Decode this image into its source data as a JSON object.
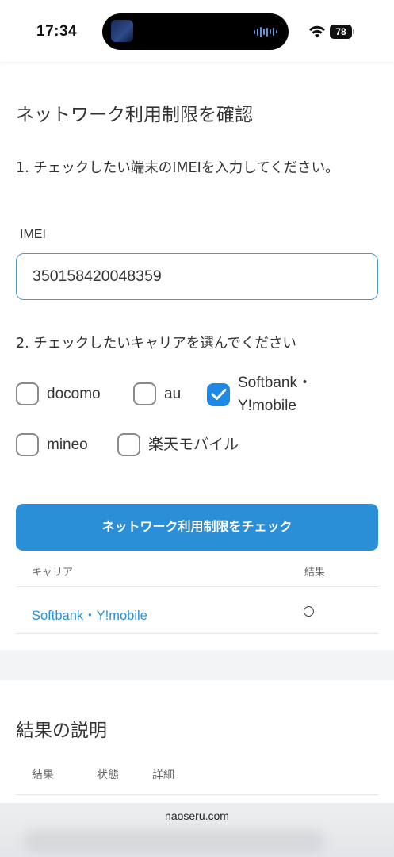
{
  "status_bar": {
    "time": "17:34",
    "battery": "78",
    "icons": [
      "wifi-icon",
      "battery-icon",
      "audio-wave-icon"
    ]
  },
  "page": {
    "title": "ネットワーク利用制限を確認",
    "step1": "1. チェックしたい端末のIMEIを入力してください。",
    "imei_label": "IMEI",
    "imei_value": "350158420048359",
    "step2": "2. チェックしたいキャリアを選んでください",
    "carriers": [
      {
        "label": "docomo",
        "checked": false
      },
      {
        "label": "au",
        "checked": false
      },
      {
        "label": "Softbank・Y!mobile",
        "checked": true
      },
      {
        "label": "mineo",
        "checked": false
      },
      {
        "label": "楽天モバイル",
        "checked": false
      }
    ],
    "check_button": "ネットワーク利用制限をチェック",
    "result_table": {
      "headers": [
        "キャリア",
        "結果"
      ],
      "rows": [
        {
          "carrier": "Softbank・Y!mobile",
          "result": "○"
        }
      ]
    },
    "explanation": {
      "title": "結果の説明",
      "headers": [
        "結果",
        "状態",
        "詳細"
      ]
    }
  },
  "browser": {
    "url": "naoseru.com"
  },
  "colors": {
    "accent": "#2a8fd6",
    "link": "#2b8fd1",
    "checkbox_checked": "#1e88e5"
  }
}
